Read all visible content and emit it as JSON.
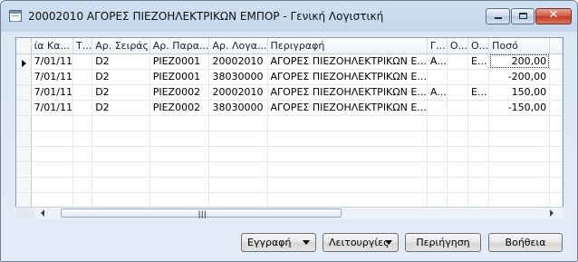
{
  "window": {
    "title": "20002010 ΑΓΟΡΕΣ ΠΙΕΖΟΗΛΕΚΤΡΙΚΩΝ ΕΜΠΟΡ - Γενική Λογιστική",
    "min_icon": "minimize-icon",
    "max_icon": "maximize-icon",
    "close_icon": "close-icon"
  },
  "grid": {
    "columns": [
      "ία Κα...",
      "Τ...",
      "Αρ. Σειράς",
      "Αρ. Παρα...",
      "Αρ. Λογα...",
      "Περιγραφή",
      "Γ...",
      "Ο...",
      "Ο...",
      "Ποσό"
    ],
    "rows": [
      {
        "date": "7/01/11",
        "type": "",
        "series": "D2",
        "doc": "PIEZ0001",
        "account": "20002010",
        "description": "ΑΓΟΡΕΣ ΠΙΕΖΟΗΛΕΚΤΡΙΚΩΝ Ε...",
        "g": "Α...",
        "o1": "",
        "o2": "Ε...",
        "amount": "200,00",
        "selected": true
      },
      {
        "date": "7/01/11",
        "type": "",
        "series": "D2",
        "doc": "PIEZ0001",
        "account": "38030000",
        "description": "ΑΓΟΡΕΣ ΠΙΕΖΟΗΛΕΚΤΡΙΚΩΝ Ε...",
        "g": "",
        "o1": "",
        "o2": "",
        "amount": "-200,00",
        "selected": false
      },
      {
        "date": "7/01/11",
        "type": "",
        "series": "D2",
        "doc": "PIEZ0002",
        "account": "20002010",
        "description": "ΑΓΟΡΕΣ ΠΙΕΖΟΗΛΕΚΤΡΙΚΩΝ Ε...",
        "g": "Α...",
        "o1": "",
        "o2": "Ε...",
        "amount": "150,00",
        "selected": false
      },
      {
        "date": "7/01/11",
        "type": "",
        "series": "D2",
        "doc": "PIEZ0002",
        "account": "38030000",
        "description": "ΑΓΟΡΕΣ ΠΙΕΖΟΗΛΕΚΤΡΙΚΩΝ Ε...",
        "g": "",
        "o1": "",
        "o2": "",
        "amount": "-150,00",
        "selected": false
      }
    ],
    "empty_rows": 6
  },
  "buttons": {
    "entry": "Εγγραφή",
    "functions": "Λειτουργίες",
    "navigate": "Περιήγηση",
    "help": "Βοήθεια"
  }
}
